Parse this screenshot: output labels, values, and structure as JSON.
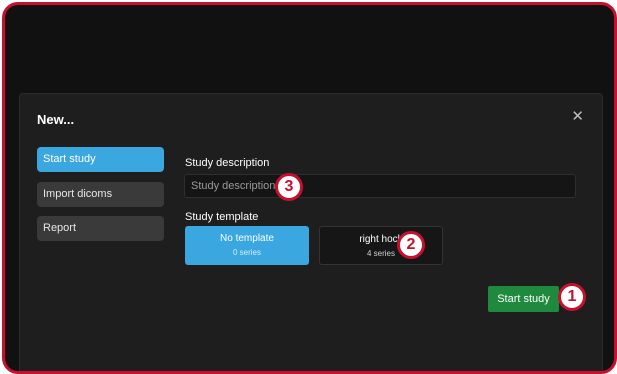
{
  "dialog": {
    "title": "New...",
    "close_icon": "close-icon"
  },
  "sidebar": {
    "items": [
      {
        "label": "Start study",
        "active": true
      },
      {
        "label": "Import dicoms",
        "active": false
      },
      {
        "label": "Report",
        "active": false
      }
    ]
  },
  "form": {
    "description_label": "Study description",
    "description_placeholder": "Study description",
    "description_value": "",
    "template_label": "Study template",
    "templates": [
      {
        "name": "No template",
        "count": "0 series",
        "selected": true
      },
      {
        "name": "right hock",
        "count": "4 series",
        "selected": false
      }
    ],
    "start_button": "Start study"
  },
  "callouts": [
    "1",
    "2",
    "3"
  ],
  "colors": {
    "accent": "#3aa7e0",
    "primary_button": "#1f8a3e",
    "callout": "#c8102e",
    "background": "#1e1e1f"
  }
}
